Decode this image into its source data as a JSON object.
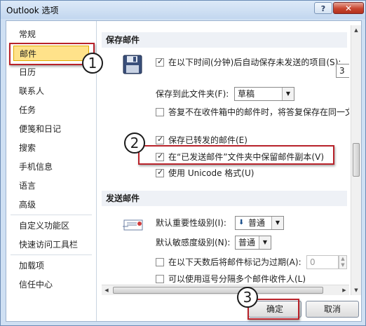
{
  "window": {
    "title": "Outlook 选项",
    "help_icon": "?",
    "close_icon": "✕"
  },
  "sidebar": {
    "items": [
      {
        "label": "常规"
      },
      {
        "label": "邮件"
      },
      {
        "label": "日历"
      },
      {
        "label": "联系人"
      },
      {
        "label": "任务"
      },
      {
        "label": "便笺和日记"
      },
      {
        "label": "搜索"
      },
      {
        "label": "手机信息"
      },
      {
        "label": "语言"
      },
      {
        "label": "高级"
      },
      {
        "label": "自定义功能区"
      },
      {
        "label": "快速访问工具栏"
      },
      {
        "label": "加载项"
      },
      {
        "label": "信任中心"
      }
    ],
    "selected": "邮件"
  },
  "save_section": {
    "header": "保存邮件",
    "autosave_label": "在以下时间(分钟)后自动保存未发送的项目(S):",
    "autosave_value": "3",
    "save_folder_label": "保存到此文件夹(F):",
    "save_folder_value": "草稿",
    "reply_label": "答复不在收件箱中的邮件时，将答复保存在同一文件夹中(M)",
    "forward_label": "保存已转发的邮件(E)",
    "copy_sent_label": "在“已发送邮件”文件夹中保留邮件副本(V)",
    "unicode_label": "使用 Unicode 格式(U)"
  },
  "send_section": {
    "header": "发送邮件",
    "importance_label": "默认重要性级别(I):",
    "importance_value": "普通",
    "sensitivity_label": "默认敏感度级别(N):",
    "sensitivity_value": "普通",
    "expire_label": "在以下天数后将邮件标记为过期(A):",
    "expire_value": "0",
    "comma_label": "可以使用逗号分隔多个邮件收件人(L)"
  },
  "buttons": {
    "ok": "确定",
    "cancel": "取消"
  },
  "callouts": [
    "1",
    "2",
    "3"
  ],
  "colors": {
    "highlight_red": "#b8222a",
    "selected_nav": "#ffe28a"
  },
  "icons": {
    "save_icon": "floppy-disk",
    "message_icon": "envelope"
  }
}
